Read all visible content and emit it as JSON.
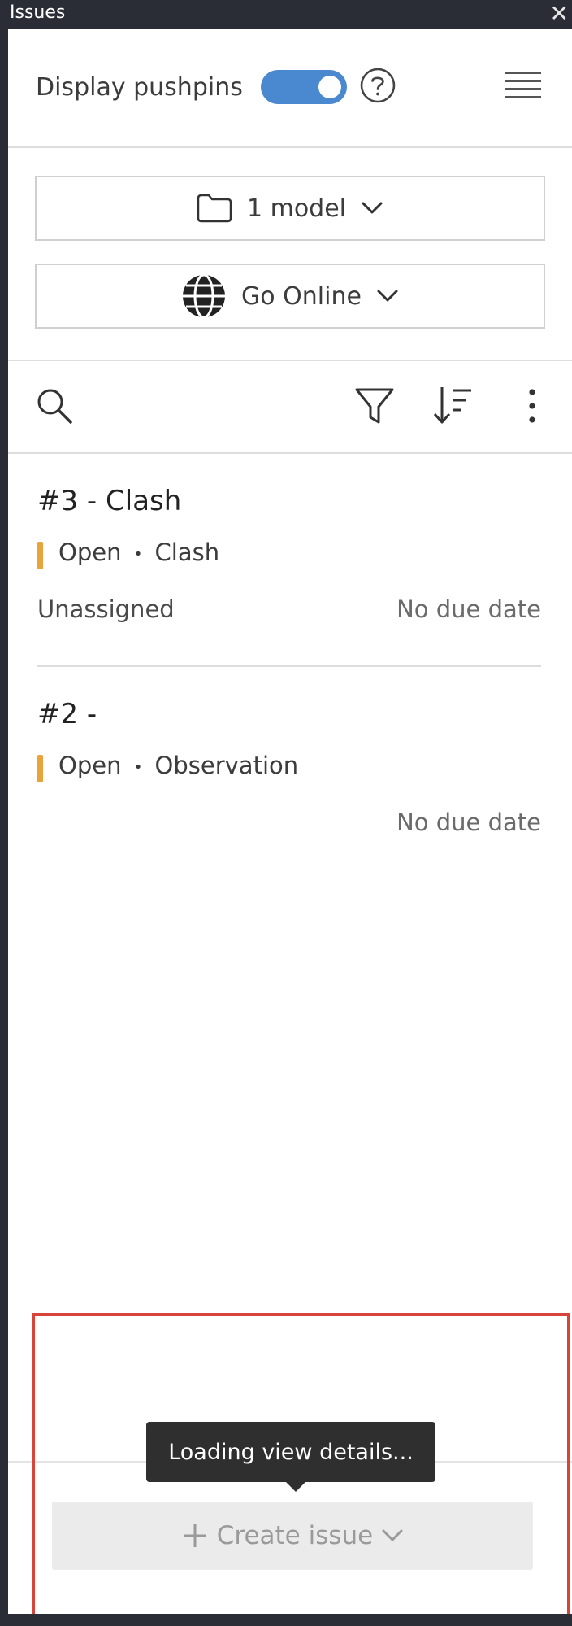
{
  "window": {
    "title": "Issues",
    "close_glyph": "✕"
  },
  "toolbar": {
    "display_pushpins_label": "Display pushpins",
    "display_pushpins_on": true,
    "help_icon": "help-circle-icon",
    "menu_icon": "list-menu-icon"
  },
  "selectors": {
    "model": {
      "label": "1 model",
      "icon": "folder-icon"
    },
    "online": {
      "label": "Go Online",
      "icon": "globe-icon"
    }
  },
  "actions": {
    "search_icon": "search-icon",
    "filter_icon": "filter-icon",
    "sort_icon": "sort-icon",
    "more_icon": "more-vertical-icon"
  },
  "issues": [
    {
      "title": "#3 - Clash",
      "status": "Open",
      "type": "Clash",
      "assignee": "Unassigned",
      "due": "No due date"
    },
    {
      "title": "#2 -",
      "status": "Open",
      "type": "Observation",
      "assignee": "",
      "due": "No due date"
    }
  ],
  "separator": "•",
  "tooltip": {
    "text": "Loading view details..."
  },
  "create_button": {
    "label": "Create issue"
  },
  "colors": {
    "accent": "#4a88cf",
    "status_open": "#e8a33a",
    "highlight": "#d9443a"
  }
}
